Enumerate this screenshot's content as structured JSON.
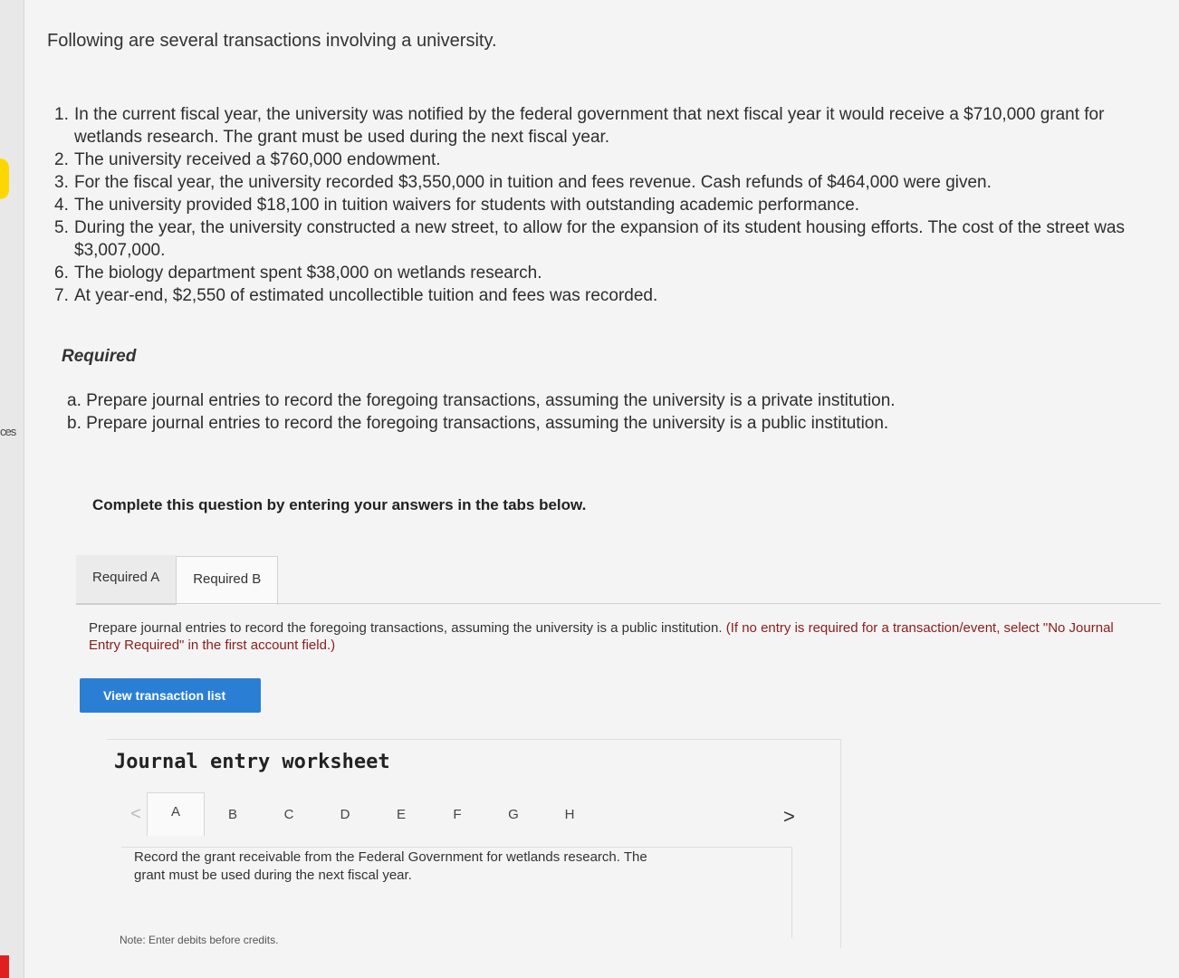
{
  "intro": "Following are several transactions involving a university.",
  "transactions": [
    {
      "num": "1.",
      "text": "In the current fiscal year, the university was notified by the federal government that next fiscal year it would receive a $710,000 grant for wetlands research. The grant must be used during the next fiscal year."
    },
    {
      "num": "2.",
      "text": "The university received a $760,000 endowment."
    },
    {
      "num": "3.",
      "text": "For the fiscal year, the university recorded $3,550,000 in tuition and fees revenue. Cash refunds of $464,000 were given."
    },
    {
      "num": "4.",
      "text": "The university provided $18,100 in tuition waivers for students with outstanding academic performance."
    },
    {
      "num": "5.",
      "text": "During the year, the university constructed a new street, to allow for the expansion of its student housing efforts. The cost of the street was $3,007,000."
    },
    {
      "num": "6.",
      "text": "The biology department spent $38,000 on wetlands research."
    },
    {
      "num": "7.",
      "text": "At year-end, $2,550 of estimated uncollectible tuition and fees was recorded."
    }
  ],
  "required": {
    "heading": "Required",
    "items": [
      "a. Prepare journal entries to record the foregoing transactions, assuming the university is a private institution.",
      "b. Prepare journal entries to record the foregoing transactions, assuming the university is a public institution."
    ]
  },
  "complete_note": "Complete this question by entering your answers in the tabs below.",
  "tabs": [
    "Required A",
    "Required B"
  ],
  "instructions": {
    "main": "Prepare journal entries to record the foregoing transactions, assuming the university is a public institution.",
    "hint": "(If no entry is required for a transaction/event, select \"No Journal Entry Required\" in the first account field.)"
  },
  "view_button": "View transaction list",
  "worksheet": {
    "title": "Journal entry worksheet",
    "prev": "<",
    "next": ">",
    "tabs": [
      "A",
      "B",
      "C",
      "D",
      "E",
      "F",
      "G",
      "H"
    ],
    "description": "Record the grant receivable from the Federal Government for wetlands research. The grant must be used during the next fiscal year.",
    "note": "Note: Enter debits before credits."
  },
  "side_text": "ces",
  "colors": {
    "button": "#2a7fd4",
    "hint": "#8a1d1d",
    "left_yellow": "#ffd700",
    "left_red": "#e02020"
  }
}
